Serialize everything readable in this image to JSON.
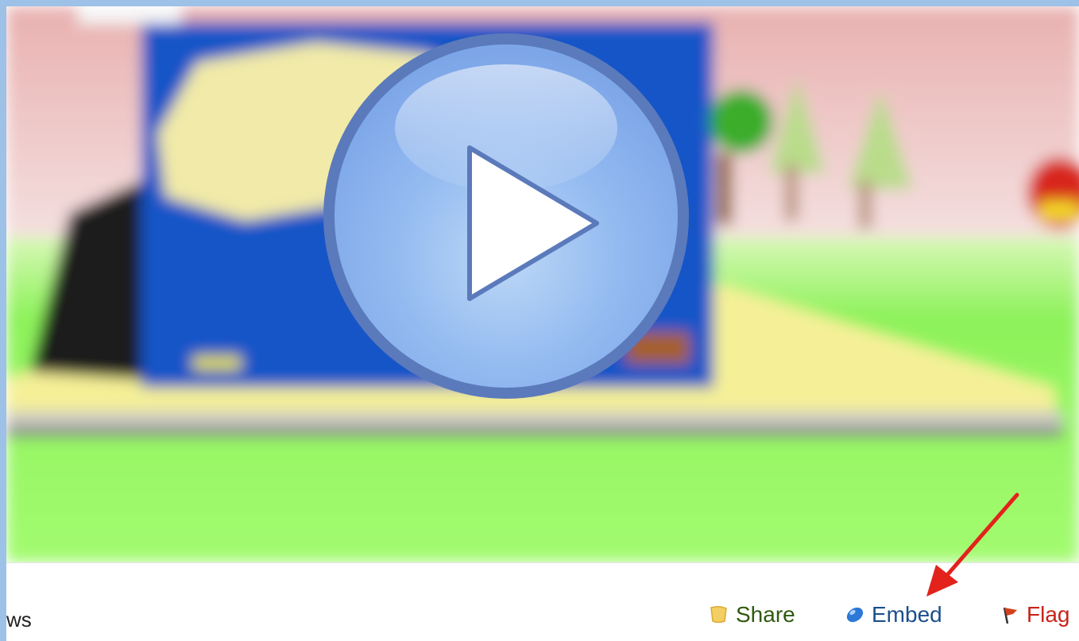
{
  "video": {
    "play_button_icon": "play-icon"
  },
  "bar": {
    "views_text": "ws",
    "actions": [
      {
        "label": "Share",
        "icon": "share-icon",
        "color": "#2e5a10"
      },
      {
        "label": "Embed",
        "icon": "embed-icon",
        "color": "#1c4f8c"
      },
      {
        "label": "Flag",
        "icon": "flag-icon",
        "color": "#c8231a"
      }
    ]
  },
  "colors": {
    "frame_border": "#9ec1e8",
    "play_button_fill": "#8db3ee",
    "play_button_ring": "#5b7abb",
    "annotation_arrow": "#e3221c"
  }
}
